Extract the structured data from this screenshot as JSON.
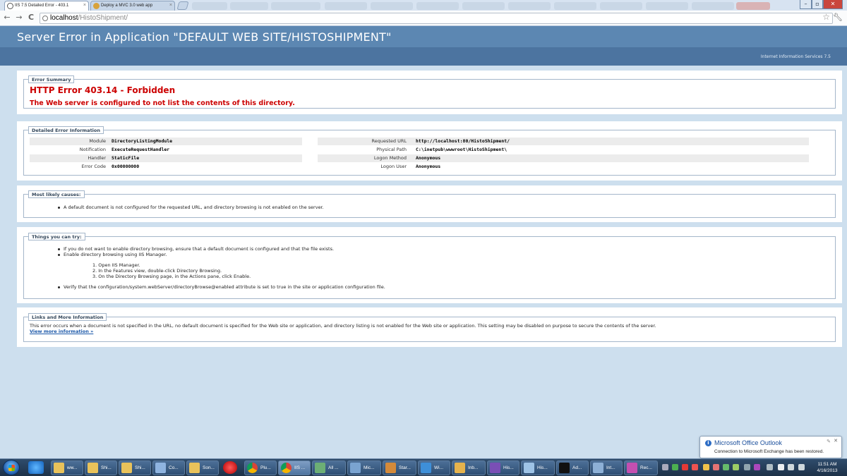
{
  "browser": {
    "tabs": [
      {
        "title": "IIS 7.5 Detailed Error - 403.1",
        "active": true
      },
      {
        "title": "Deploy a MVC 3.0 web app",
        "active": false
      }
    ],
    "address": {
      "host": "localhost",
      "path": "/HistoShipment/"
    },
    "window_controls": {
      "minimize": "–",
      "maximize": "▫",
      "close": "✕"
    },
    "nav": {
      "back": "←",
      "forward": "→",
      "reload": "C"
    }
  },
  "page": {
    "header_title": "Server Error in Application \"DEFAULT WEB SITE/HISTOSHIPMENT\"",
    "iis_version": "Internet Information Services 7.5",
    "error_summary": {
      "legend": "Error Summary",
      "title": "HTTP Error 403.14 - Forbidden",
      "subtitle": "The Web server is configured to not list the contents of this directory."
    },
    "detailed": {
      "legend": "Detailed Error Information",
      "left": [
        {
          "label": "Module",
          "value": "DirectoryListingModule"
        },
        {
          "label": "Notification",
          "value": "ExecuteRequestHandler"
        },
        {
          "label": "Handler",
          "value": "StaticFile"
        },
        {
          "label": "Error Code",
          "value": "0x00000000"
        }
      ],
      "right": [
        {
          "label": "Requested URL",
          "value": "http://localhost:80/HistoShipment/"
        },
        {
          "label": "Physical Path",
          "value": "C:\\inetpub\\wwwroot\\HistoShipment\\"
        },
        {
          "label": "Logon Method",
          "value": "Anonymous"
        },
        {
          "label": "Logon User",
          "value": "Anonymous"
        }
      ]
    },
    "causes": {
      "legend": "Most likely causes:",
      "items": [
        "A default document is not configured for the requested URL, and directory browsing is not enabled on the server."
      ]
    },
    "try": {
      "legend": "Things you can try:",
      "bullets": [
        "If you do not want to enable directory browsing, ensure that a default document is configured and that the file exists.",
        "Enable directory browsing using IIS Manager."
      ],
      "steps": [
        "1. Open IIS Manager.",
        "2. In the Features view, double-click Directory Browsing.",
        "3. On the Directory Browsing page, in the Actions pane, click Enable."
      ],
      "last_bullet": "Verify that the configuration/system.webServer/directoryBrowse@enabled attribute is set to true in the site or application configuration file."
    },
    "links": {
      "legend": "Links and More Information",
      "text": "This error occurs when a document is not specified in the URL, no default document is specified for the Web site or application, and directory listing is not enabled for the Web site or application. This setting may be disabled on purpose to secure the contents of the server.",
      "link": "View more information »"
    }
  },
  "notification": {
    "title": "Microsoft Office Outlook",
    "message": "Connection to Microsoft Exchange has been restored."
  },
  "taskbar": {
    "items": [
      "ww...",
      "Shi...",
      "Shi...",
      "Co...",
      "Son...",
      "Plu...",
      "IIS ...",
      "All ...",
      "Mic...",
      "Star...",
      "Wi...",
      "Inb...",
      "His...",
      "His...",
      "Ad...",
      "Int...",
      "Rec..."
    ],
    "time": "11:51 AM",
    "date": "4/16/2013"
  },
  "colors": {
    "header": "#5c87b2",
    "subheader": "#4c74a0",
    "error_red": "#cc0000",
    "page_bg": "#cddfee"
  }
}
